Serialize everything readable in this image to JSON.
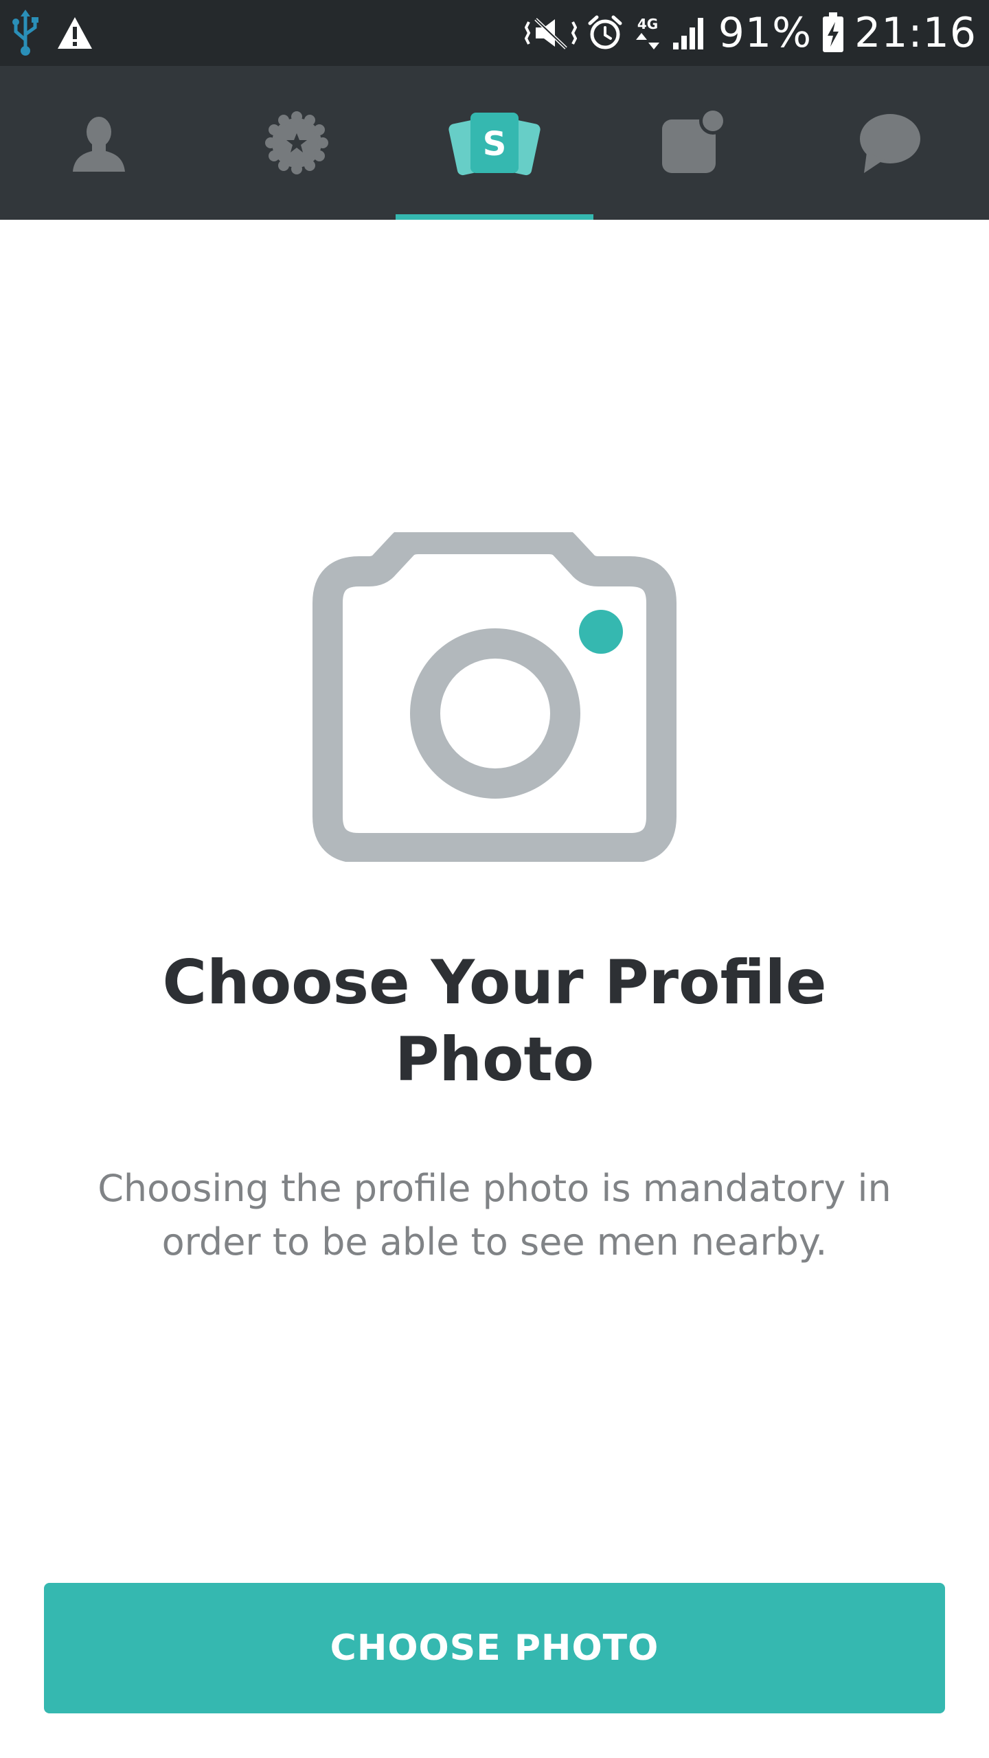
{
  "status_bar": {
    "battery": "91%",
    "time": "21:16",
    "network": "4G",
    "icons": [
      "usb-icon",
      "warning-icon",
      "vibrate-icon",
      "alarm-icon",
      "network-4g-icon",
      "signal-icon",
      "battery-charging-icon"
    ]
  },
  "tabs": [
    {
      "icon": "profile-icon",
      "active": false
    },
    {
      "icon": "badge-star-icon",
      "active": false
    },
    {
      "icon": "swipe-cards-icon",
      "glyph": "S",
      "active": true
    },
    {
      "icon": "notification-icon",
      "active": false
    },
    {
      "icon": "chat-bubble-icon",
      "active": false
    }
  ],
  "main": {
    "illustration": "camera-icon",
    "title": "Choose Your Profile Photo",
    "description": "Choosing the profile photo is mandatory in order to be able to see men nearby.",
    "button_label": "CHOOSE PHOTO"
  },
  "colors": {
    "accent": "#35b8b0",
    "status_bar_bg": "#25292c",
    "tab_bar_bg": "#32373b",
    "inactive_icon": "#767a7d",
    "illustration_gray": "#b2b8bc",
    "title_text": "#2d3034",
    "body_text": "#808386",
    "usb_icon": "#2a8fb8"
  }
}
